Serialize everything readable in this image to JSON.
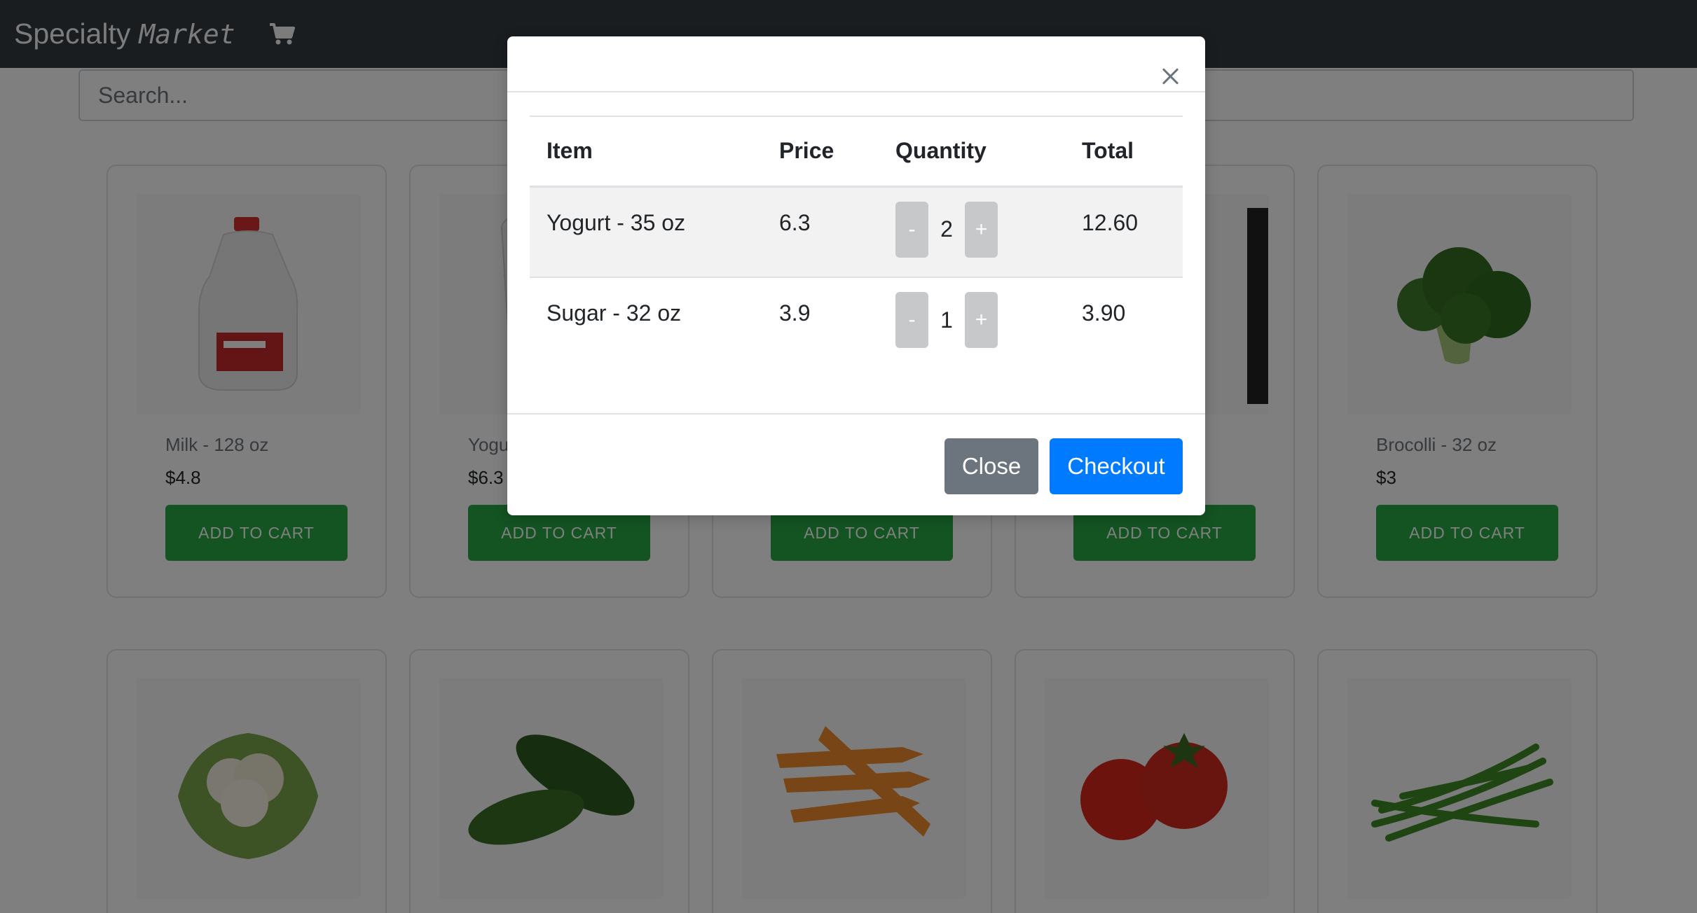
{
  "navbar": {
    "brand_main": "Specialty",
    "brand_accent": "Market"
  },
  "search": {
    "placeholder": "Search..."
  },
  "products": [
    {
      "name": "Milk - 128 oz",
      "price": "$4.8",
      "button": "ADD TO CART"
    },
    {
      "name": "Yogurt - 35 oz",
      "price": "$6.3",
      "button": "ADD TO CART"
    },
    {
      "name": "",
      "price": "",
      "button": "ADD TO CART"
    },
    {
      "name": "",
      "price": "",
      "button": "ADD TO CART"
    },
    {
      "name": "Brocolli - 32 oz",
      "price": "$3",
      "button": "ADD TO CART"
    }
  ],
  "cart_modal": {
    "columns": [
      "Item",
      "Price",
      "Quantity",
      "Total"
    ],
    "rows": [
      {
        "item": "Yogurt - 35 oz",
        "price": "6.3",
        "quantity": "2",
        "total": "12.60"
      },
      {
        "item": "Sugar - 32 oz",
        "price": "3.9",
        "quantity": "1",
        "total": "3.90"
      }
    ],
    "decrement_label": "-",
    "increment_label": "+",
    "close_label": "Close",
    "checkout_label": "Checkout"
  },
  "colors": {
    "navbar": "#343a40",
    "add_to_cart": "#28a745",
    "checkout": "#007bff",
    "close": "#6c757d"
  }
}
